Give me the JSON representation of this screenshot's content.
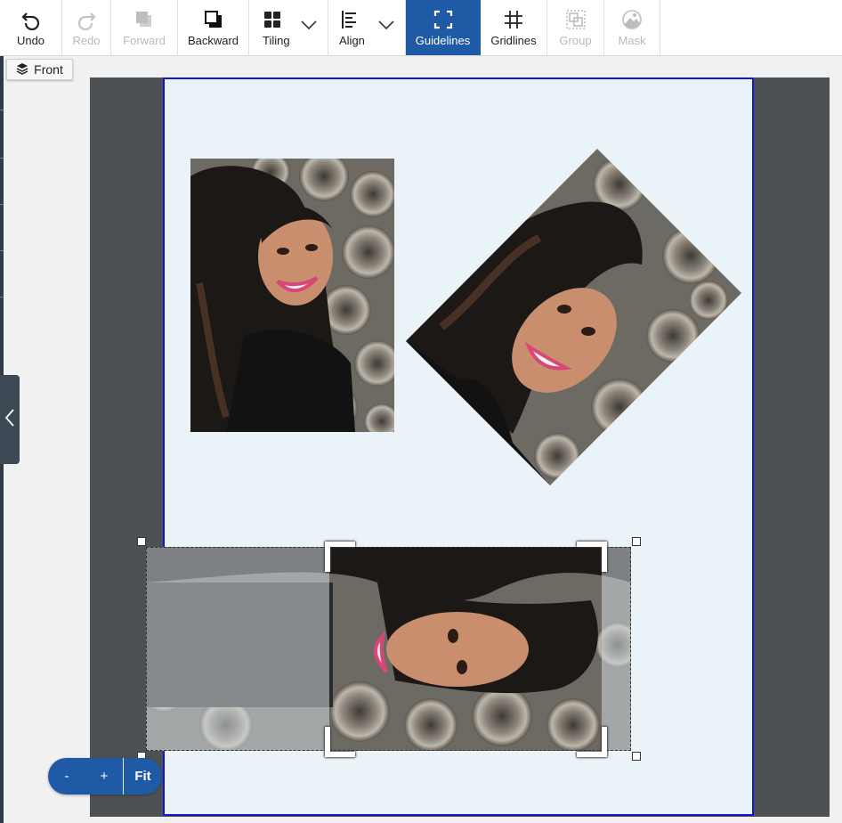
{
  "toolbar": {
    "undo": "Undo",
    "redo": "Redo",
    "forward": "Forward",
    "backward": "Backward",
    "tiling": "Tiling",
    "align": "Align",
    "guidelines": "Guidelines",
    "gridlines": "Gridlines",
    "group": "Group",
    "mask": "Mask"
  },
  "layer_tab": {
    "label": "Front"
  },
  "zoom": {
    "minus": "-",
    "plus": "+",
    "fit": "Fit"
  },
  "colors": {
    "accent": "#1f5aa6",
    "page_border": "#1515d0",
    "page_bg": "#eaf3f8",
    "bleed": "#4d5153",
    "disabled": "#b9b9b9"
  },
  "icons": {
    "undo": "undo-icon",
    "redo": "redo-icon",
    "forward": "bring-forward-icon",
    "backward": "send-backward-icon",
    "tiling": "tiling-icon",
    "align": "align-icon",
    "guidelines": "guidelines-icon",
    "gridlines": "gridlines-icon",
    "group": "group-icon",
    "mask": "mask-icon",
    "layers": "layers-icon",
    "collapse": "chevron-left-icon"
  }
}
